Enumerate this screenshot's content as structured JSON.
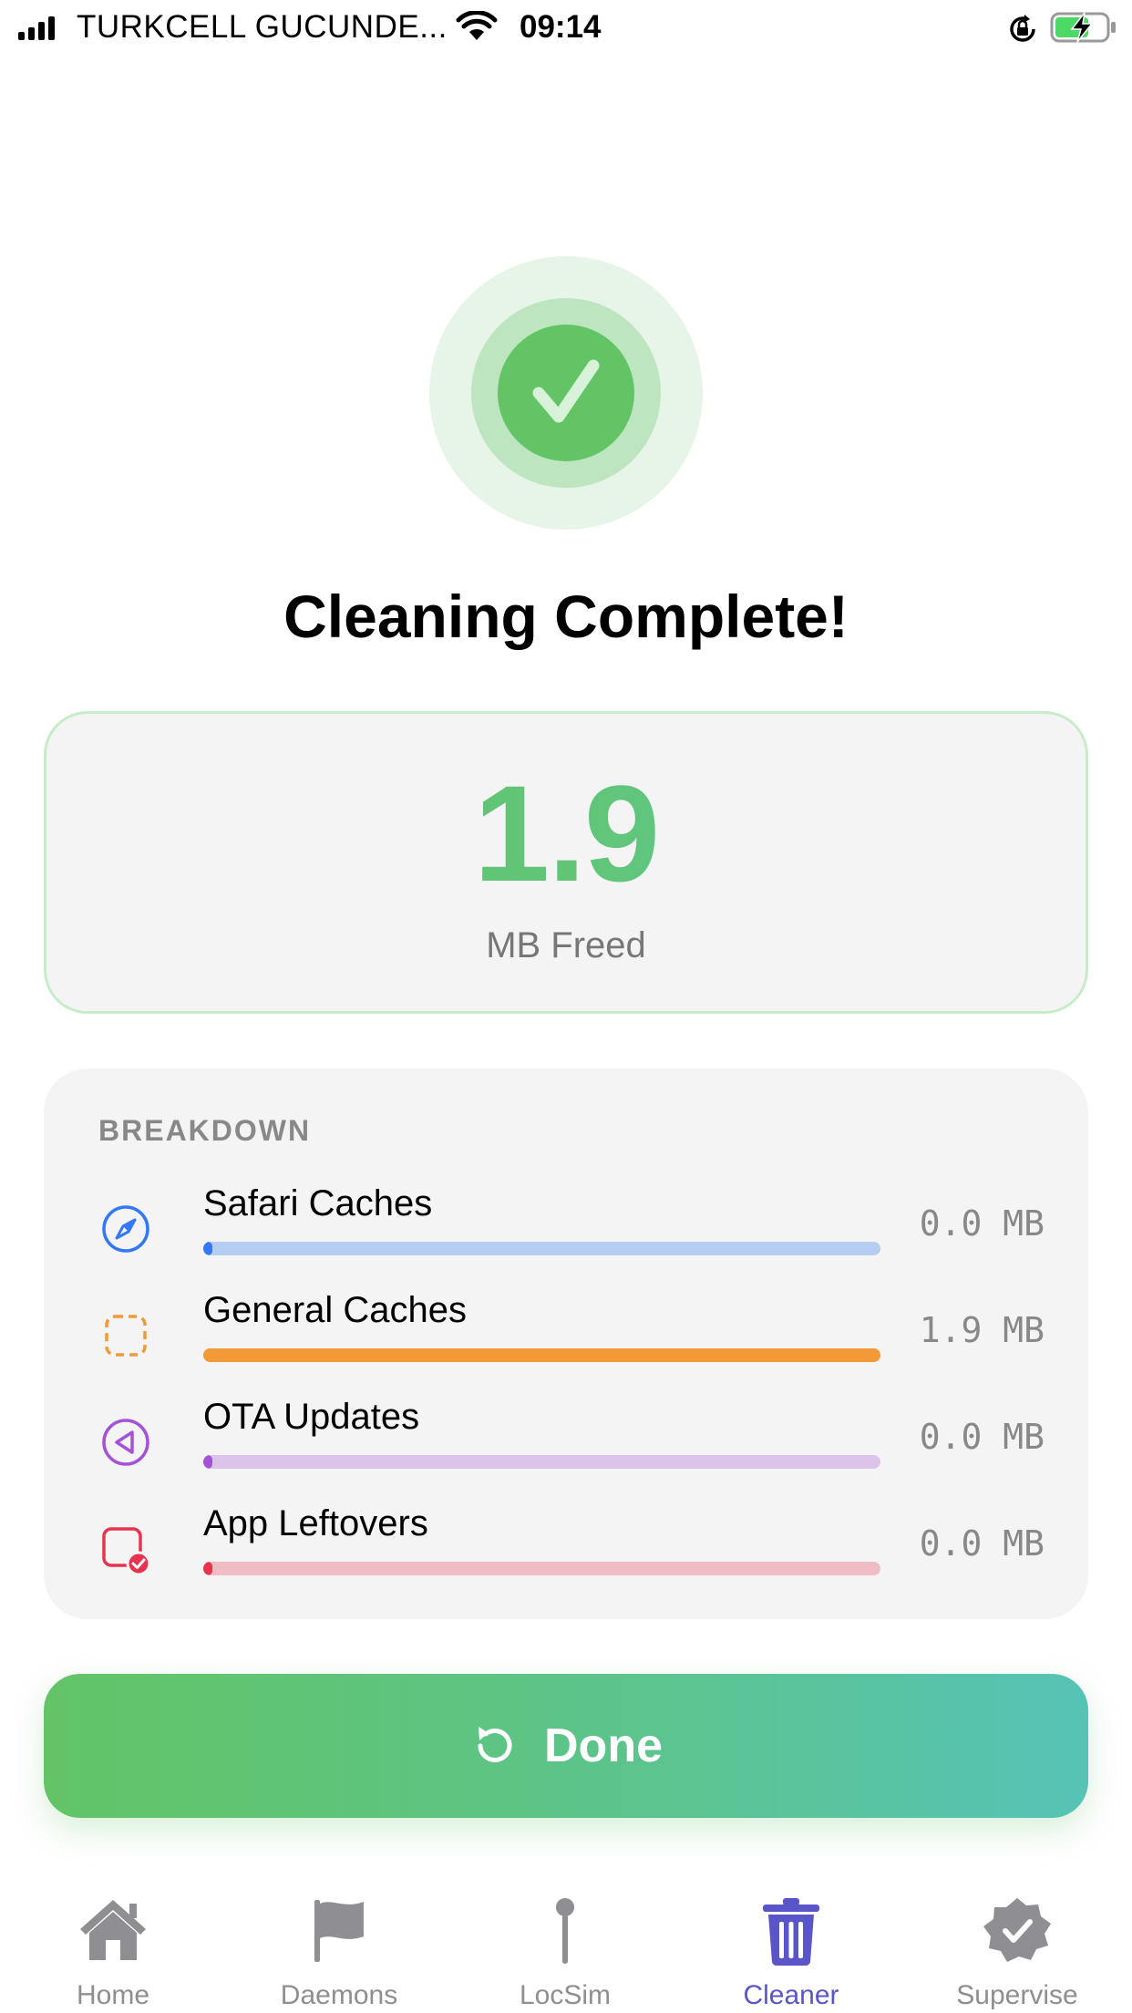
{
  "status_bar": {
    "carrier": "TURKCELL GUCUNDE...",
    "time": "09:14"
  },
  "result": {
    "title": "Cleaning Complete!",
    "freed_value": "1.9",
    "freed_unit": "MB Freed"
  },
  "breakdown": {
    "header": "BREAKDOWN",
    "items": [
      {
        "label": "Safari Caches",
        "size": "0.0 MB",
        "fraction": 0.0,
        "icon": "compass-icon",
        "color": "#3478f6",
        "track": "#b5cdf1"
      },
      {
        "label": "General Caches",
        "size": "1.9 MB",
        "fraction": 1.0,
        "icon": "dashed-square-icon",
        "color": "#f29a38",
        "track": "#f29a38"
      },
      {
        "label": "OTA Updates",
        "size": "0.0 MB",
        "fraction": 0.0,
        "icon": "play-back-circle-icon",
        "color": "#a553d6",
        "track": "#dbc3ea"
      },
      {
        "label": "App Leftovers",
        "size": "0.0 MB",
        "fraction": 0.0,
        "icon": "app-badge-check-icon",
        "color": "#e8334e",
        "track": "#efbcc4"
      }
    ]
  },
  "done_button": {
    "label": "Done"
  },
  "tabs": [
    {
      "label": "Home",
      "icon": "house-icon",
      "active": false
    },
    {
      "label": "Daemons",
      "icon": "flag-icon",
      "active": false
    },
    {
      "label": "LocSim",
      "icon": "pin-icon",
      "active": false
    },
    {
      "label": "Cleaner",
      "icon": "trash-icon",
      "active": true
    },
    {
      "label": "Supervise",
      "icon": "checkmark-seal-icon",
      "active": false
    }
  ],
  "colors": {
    "accent_green": "#63c466",
    "accent_teal": "#57c3b6",
    "tab_active": "#5a55c8",
    "tab_inactive": "#8e8e93"
  }
}
